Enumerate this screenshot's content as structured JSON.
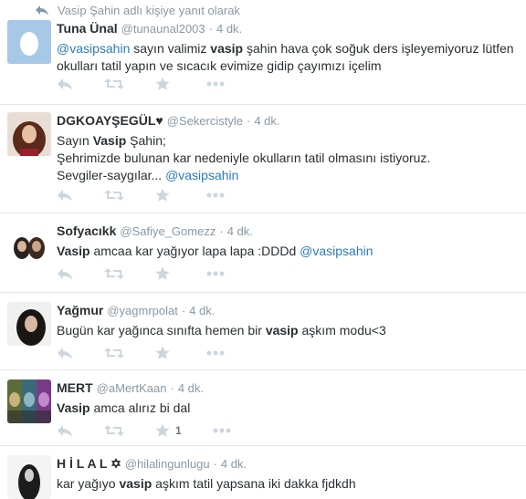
{
  "reply_context": "Vasip Şahin adlı kişiye yanıt olarak",
  "tweets": [
    {
      "name": "Tuna Ünal",
      "handle": "@tunaunal2003",
      "time": "4 dk.",
      "text": [
        {
          "t": "@vasipsahin",
          "k": "mention"
        },
        {
          "t": " sayın valimiz ",
          "k": "plain"
        },
        {
          "t": "vasip",
          "k": "bold"
        },
        {
          "t": " şahin hava çok soğuk ders işleyemiyoruz lütfen okulları tatil yapın ve sıcacık evimize gidip çayımızı içelim",
          "k": "plain"
        }
      ],
      "avatar": "default-egg-avatar",
      "fav_count": ""
    },
    {
      "name": "DGKOAYŞEGÜL♥",
      "handle": "@Sekercistyle",
      "time": "4 dk.",
      "text": [
        {
          "t": "Sayın ",
          "k": "plain"
        },
        {
          "t": "Vasip",
          "k": "bold"
        },
        {
          "t": " Şahin;",
          "k": "plain"
        },
        {
          "t": "",
          "k": "br"
        },
        {
          "t": "Şehrimizde bulunan kar nedeniyle okulların tatil olmasını istiyoruz.",
          "k": "plain"
        },
        {
          "t": "",
          "k": "br"
        },
        {
          "t": "Sevgiler-saygılar... ",
          "k": "plain"
        },
        {
          "t": "@vasipsahin",
          "k": "mention"
        }
      ],
      "avatar": "photo-avatar",
      "fav_count": ""
    },
    {
      "name": "Sofyacıkk",
      "handle": "@Safiye_Gomezz",
      "time": "4 dk.",
      "text": [
        {
          "t": "Vasip",
          "k": "bold"
        },
        {
          "t": " amcaa kar yağıyor lapa lapa :DDDd ",
          "k": "plain"
        },
        {
          "t": "@vasipsahin",
          "k": "mention"
        }
      ],
      "avatar": "photo-avatar",
      "fav_count": ""
    },
    {
      "name": "Yağmur",
      "handle": "@yagmrpolat",
      "time": "4 dk.",
      "text": [
        {
          "t": "Bugün kar yağınca sınıfta hemen bir ",
          "k": "plain"
        },
        {
          "t": "vasip",
          "k": "bold"
        },
        {
          "t": " aşkım modu<3",
          "k": "plain"
        }
      ],
      "avatar": "photo-avatar",
      "fav_count": ""
    },
    {
      "name": "MERT",
      "handle": "@aMertKaan",
      "time": "4 dk.",
      "text": [
        {
          "t": "Vasip",
          "k": "bold"
        },
        {
          "t": " amca alırız bi dal",
          "k": "plain"
        }
      ],
      "avatar": "photo-avatar",
      "fav_count": "1"
    },
    {
      "name": "H İ L A L ✡",
      "handle": "@hilalingunlugu",
      "time": "4 dk.",
      "text": [
        {
          "t": "kar yağıyo ",
          "k": "plain"
        },
        {
          "t": "vasip",
          "k": "bold"
        },
        {
          "t": " aşkım tatil yapsana iki dakka fjdkdh",
          "k": "plain"
        }
      ],
      "avatar": "photo-avatar",
      "fav_count": ""
    }
  ],
  "colors": {
    "mention": "#2b7bb9",
    "meta": "#8899a6",
    "icon": "#ccd6dd",
    "border": "#e1e8ed"
  }
}
